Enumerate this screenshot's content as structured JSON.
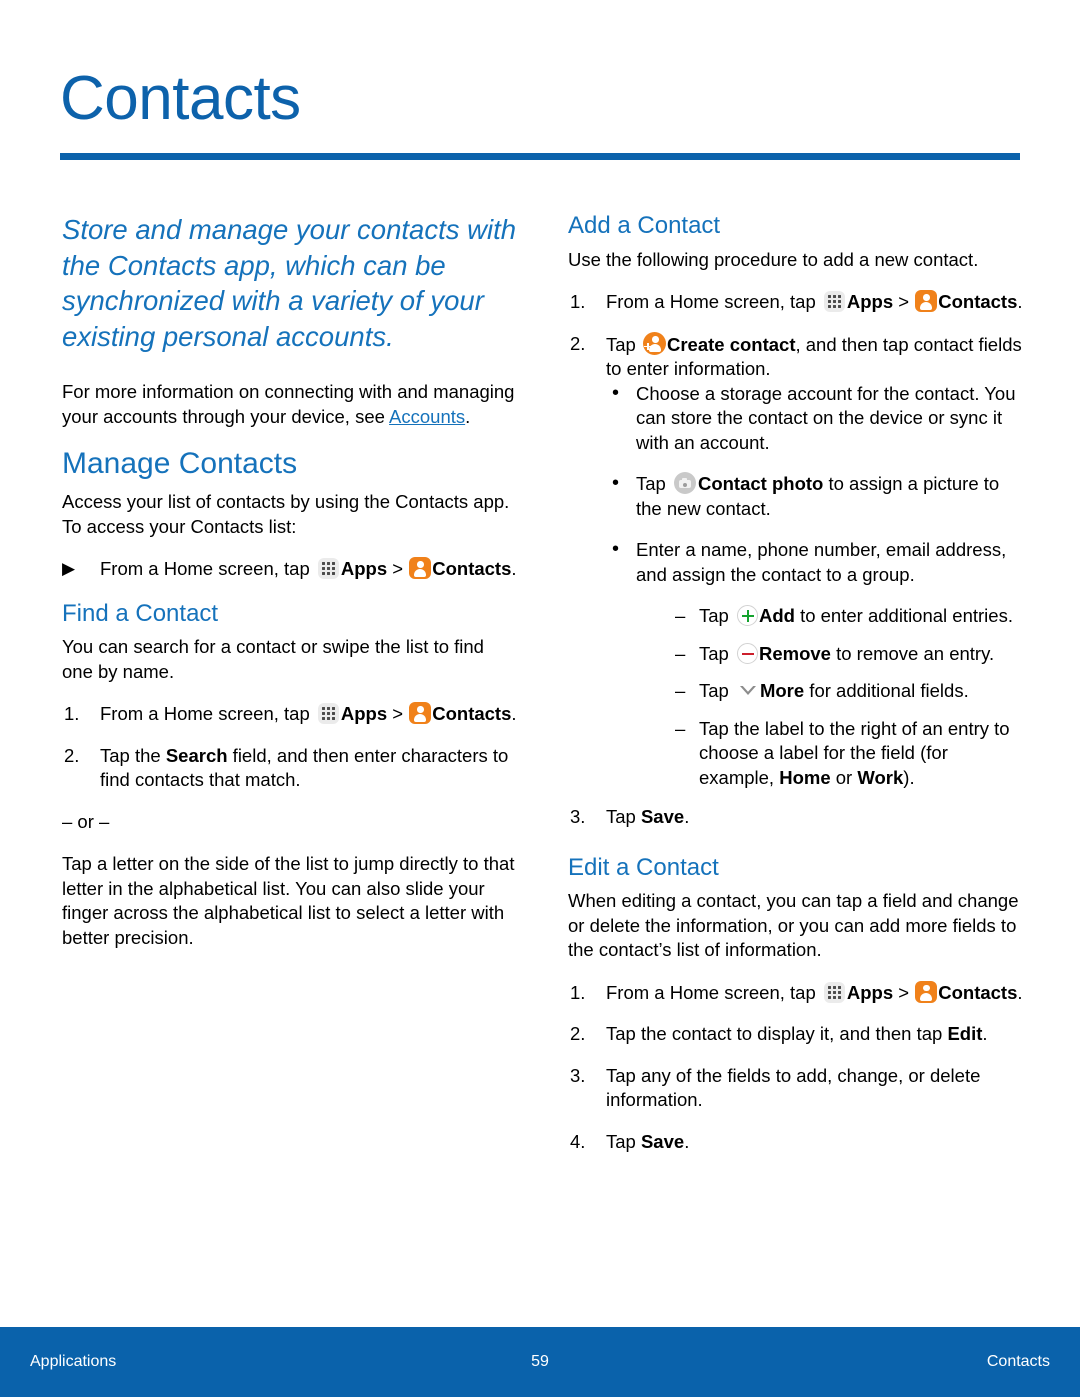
{
  "document": {
    "page_title": "Contacts",
    "accent_blue": "#0d62ab",
    "heading_blue": "#1572bb",
    "icon_orange": "#f0811a",
    "icon_green": "#14a32e",
    "icon_red": "#cc1f2c"
  },
  "left_column": {
    "lede": "Store and manage your contacts with the Contacts app, which can be synchronized with a variety of your existing personal accounts.",
    "intro_paragraph": {
      "before_link": "For more information on connecting with and managing your accounts through your device, see ",
      "link_text": "Accounts",
      "after_link": "."
    },
    "manage_contacts": {
      "heading": "Manage Contacts",
      "paragraph": "Access your list of contacts by using the Contacts app. To access your Contacts list:",
      "arrow_step": {
        "marker": "▶",
        "text_before_apps": "From a Home screen, tap ",
        "apps_label": "Apps",
        "separator": " > ",
        "contacts_label": "Contacts",
        "period": "."
      }
    },
    "find_a_contact": {
      "heading": "Find a Contact",
      "paragraph": "You can search for a contact or swipe the list to find one by name.",
      "step1": {
        "marker": "1.",
        "text_before_apps": "From a Home screen, tap ",
        "apps_label": "Apps",
        "separator": " > ",
        "contacts_label": "Contacts",
        "period": "."
      },
      "step2": {
        "marker": "2.",
        "part1": "Tap the ",
        "bold": "Search",
        "part2": " field, and then enter characters to find contacts that match."
      },
      "or_divider": "– or –",
      "alt_paragraph": "Tap a letter on the side of the list to jump directly to that letter in the alphabetical list. You can also slide your finger across the alphabetical list to select a letter with better precision."
    }
  },
  "right_column": {
    "add_a_contact": {
      "heading": "Add a Contact",
      "paragraph": "Use the following procedure to add a new contact.",
      "step1": {
        "marker": "1.",
        "text_before_apps": "From a Home screen, tap ",
        "apps_label": "Apps",
        "separator": " > ",
        "contacts_label": "Contacts",
        "period": "."
      },
      "step2": {
        "marker": "2.",
        "part1": "Tap ",
        "bold": "Create contact",
        "part2": ", and then tap contact fields to enter information."
      },
      "bullets": [
        {
          "marker": "•",
          "text": "Choose a storage account for the contact. You can store the contact on the device or sync it with an account."
        },
        {
          "marker": "•",
          "part1": "Tap ",
          "bold": "Contact photo",
          "part2": " to assign a picture to the new contact."
        },
        {
          "marker": "•",
          "text": "Enter a name, phone number, email address, and assign the contact to a group."
        }
      ],
      "dashes": [
        {
          "marker": "–",
          "part1": "Tap ",
          "bold": "Add",
          "part2": " to enter additional entries."
        },
        {
          "marker": "–",
          "part1": "Tap ",
          "bold": "Remove",
          "part2": " to remove an entry."
        },
        {
          "marker": "–",
          "part1": "Tap ",
          "bold": "More",
          "part2": " for additional fields."
        }
      ],
      "label_dash": {
        "marker": "–",
        "part1": "Tap the label to the right of an entry to choose a label for the field (for example, ",
        "bold1": "Home",
        "mid": " or ",
        "bold2": "Work",
        "part2": ")."
      },
      "step3": {
        "marker": "3.",
        "part1": "Tap ",
        "bold": "Save",
        "part2": "."
      }
    },
    "edit_a_contact": {
      "heading": "Edit a Contact",
      "paragraph": "When editing a contact, you can tap a field and change or delete the information, or you can add more fields to the contact’s list of information.",
      "step1": {
        "marker": "1.",
        "text_before_apps": "From a Home screen, tap ",
        "apps_label": "Apps",
        "separator": " > ",
        "contacts_label": "Contacts",
        "period": "."
      },
      "step2": {
        "marker": "2.",
        "part1": "Tap the contact to display it, and then tap ",
        "bold": "Edit",
        "part2": "."
      },
      "step3": {
        "marker": "3.",
        "part1": "Tap any of the fields to add, change, or delete information.",
        "bold": "",
        "part2": ""
      },
      "step4": {
        "marker": "4.",
        "part1": "Tap ",
        "bold": "Save",
        "part2": "."
      }
    }
  },
  "footer": {
    "left": "Applications",
    "page_number": "59",
    "right": "Contacts"
  }
}
